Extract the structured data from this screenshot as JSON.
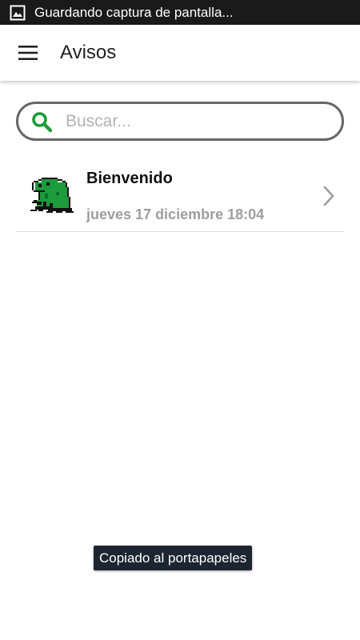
{
  "status_bar": {
    "notification_icon": "image-icon",
    "text": "Guardando captura de pantalla..."
  },
  "app_bar": {
    "menu_icon": "hamburger-menu-icon",
    "title": "Avisos"
  },
  "search": {
    "icon": "search-icon",
    "placeholder": "Buscar...",
    "value": ""
  },
  "notices": [
    {
      "icon": "frog-icon",
      "title": "Bienvenido",
      "date": "jueves 17 diciembre 18:04",
      "chevron": "chevron-right-icon"
    }
  ],
  "toast": {
    "text": "Copiado al portapapeles"
  },
  "colors": {
    "status_bar": "#1a1a1a",
    "accent_green": "#1a9a3a",
    "date_gray": "#9e9e9e",
    "toast_bg": "#1c2530"
  }
}
